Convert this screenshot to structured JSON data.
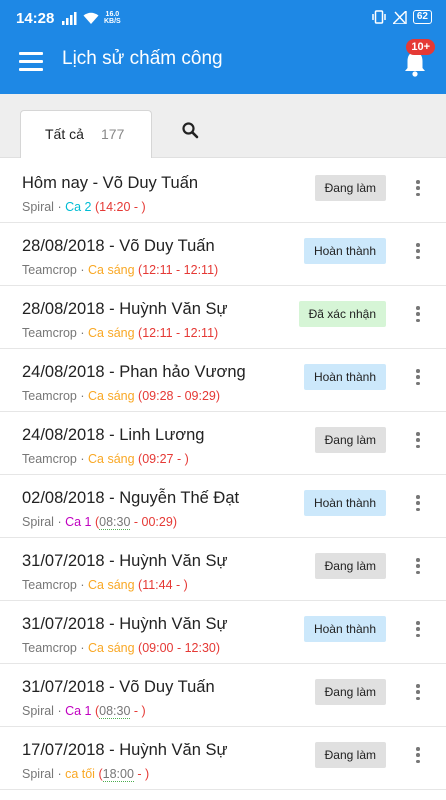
{
  "status_bar": {
    "time": "14:28",
    "net_speed": "16.0",
    "net_unit": "KB/S",
    "battery": "62"
  },
  "app_bar": {
    "title": "Lịch sử chấm công",
    "notification_badge": "10+"
  },
  "tabs": {
    "all_label": "Tất cả",
    "all_count": "177"
  },
  "colors": {
    "primary": "#1e88e5",
    "badge": "#e53935",
    "time_range": "#e53935",
    "ca_2": "#00bcd4",
    "ca_sang": "#f9a825",
    "ca_1": "#c000c0"
  },
  "records": [
    {
      "title": "Hôm nay - Võ Duy Tuấn",
      "company": "Spiral",
      "shift": "Ca 2",
      "shift_color": "#00bcd4",
      "time_range": "(14:20 - )",
      "status": "Đang làm",
      "status_type": "working"
    },
    {
      "title": "28/08/2018 - Võ Duy Tuấn",
      "company": "Teamcrop",
      "shift": "Ca sáng",
      "shift_color": "#f9a825",
      "time_range": "(12:11 - 12:11)",
      "status": "Hoàn thành",
      "status_type": "done"
    },
    {
      "title": "28/08/2018 - Huỳnh Văn Sự",
      "company": "Teamcrop",
      "shift": "Ca sáng",
      "shift_color": "#f9a825",
      "time_range": "(12:11 - 12:11)",
      "status": "Đã xác nhận",
      "status_type": "confirmed"
    },
    {
      "title": "24/08/2018 - Phan hảo Vương",
      "company": "Teamcrop",
      "shift": "Ca sáng",
      "shift_color": "#f9a825",
      "time_range": "(09:28 - 09:29)",
      "status": "Hoàn thành",
      "status_type": "done"
    },
    {
      "title": "24/08/2018 - Linh Lương",
      "company": "Teamcrop",
      "shift": "Ca sáng",
      "shift_color": "#f9a825",
      "time_range": "(09:27 - )",
      "status": "Đang làm",
      "status_type": "working"
    },
    {
      "title": "02/08/2018 - Nguyễn Thế Đạt",
      "company": "Spiral",
      "shift": "Ca 1",
      "shift_color": "#c000c0",
      "time_start": "08:30",
      "time_end": "00:29",
      "status": "Hoàn thành",
      "status_type": "done",
      "split": true
    },
    {
      "title": "31/07/2018 - Huỳnh Văn Sự",
      "company": "Teamcrop",
      "shift": "Ca sáng",
      "shift_color": "#f9a825",
      "time_range": "(11:44 - )",
      "status": "Đang làm",
      "status_type": "working"
    },
    {
      "title": "31/07/2018 - Huỳnh Văn Sự",
      "company": "Teamcrop",
      "shift": "Ca sáng",
      "shift_color": "#f9a825",
      "time_range": "(09:00 - 12:30)",
      "status": "Hoàn thành",
      "status_type": "done"
    },
    {
      "title": "31/07/2018 - Võ Duy Tuấn",
      "company": "Spiral",
      "shift": "Ca 1",
      "shift_color": "#c000c0",
      "time_start": "08:30",
      "time_end": "",
      "status": "Đang làm",
      "status_type": "working",
      "split": true
    },
    {
      "title": "17/07/2018 - Huỳnh Văn Sự",
      "company": "Spiral",
      "shift": "ca tối",
      "shift_color": "#f9a825",
      "time_start": "18:00",
      "time_end": "",
      "status": "Đang làm",
      "status_type": "working",
      "split": true
    }
  ]
}
